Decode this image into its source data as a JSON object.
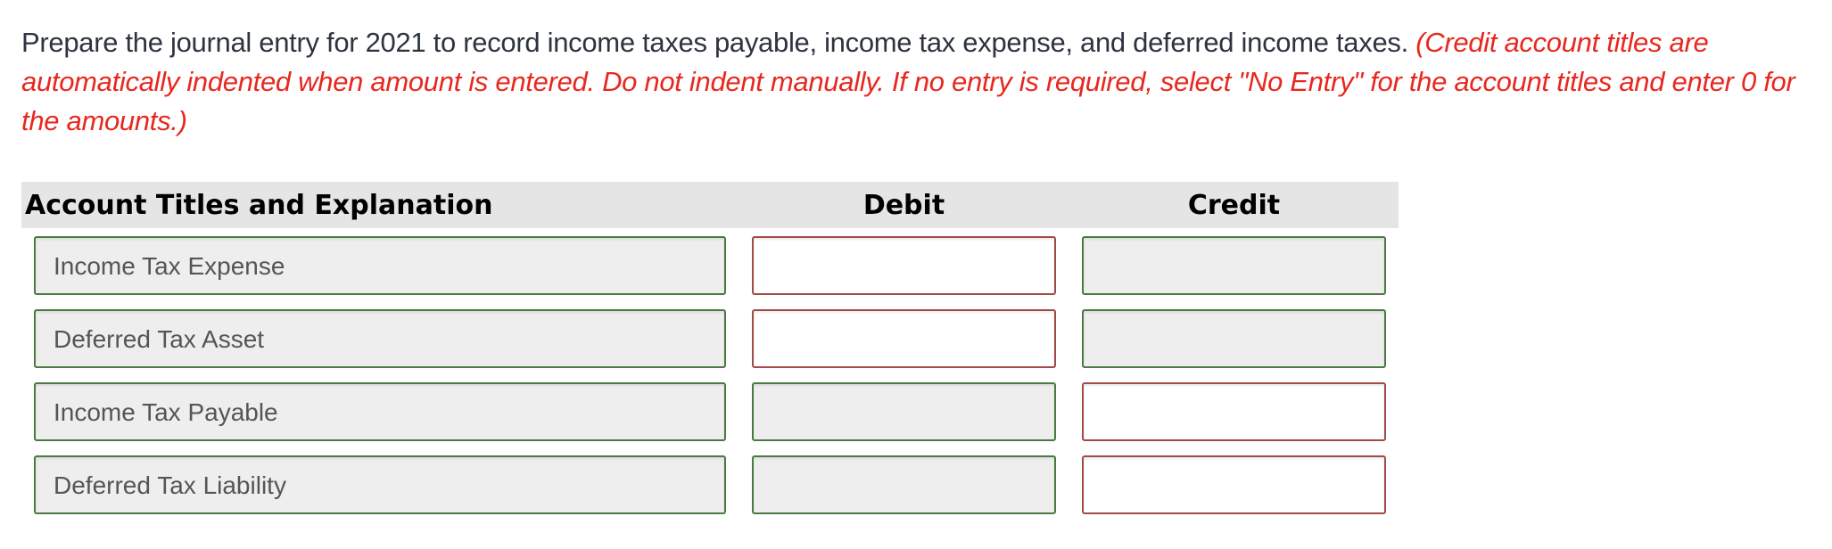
{
  "instructions": {
    "text": "Prepare the journal entry for 2021 to record income taxes payable, income tax expense, and deferred income taxes.",
    "note": "(Credit account titles are automatically indented when amount is entered. Do not indent manually. If no entry is required, select \"No Entry\" for the account titles and enter 0 for the amounts.)"
  },
  "table": {
    "headers": {
      "account": "Account Titles and Explanation",
      "debit": "Debit",
      "credit": "Credit"
    },
    "rows": [
      {
        "account": "Income Tax Expense",
        "debit": "",
        "credit": "",
        "account_status": "correct",
        "debit_status": "incorrect",
        "credit_status": "correct"
      },
      {
        "account": "Deferred Tax Asset",
        "debit": "",
        "credit": "",
        "account_status": "correct",
        "debit_status": "incorrect",
        "credit_status": "correct"
      },
      {
        "account": "Income Tax Payable",
        "debit": "",
        "credit": "",
        "account_status": "correct",
        "debit_status": "correct",
        "credit_status": "incorrect"
      },
      {
        "account": "Deferred Tax Liability",
        "debit": "",
        "credit": "",
        "account_status": "correct",
        "debit_status": "correct",
        "credit_status": "incorrect"
      }
    ]
  },
  "colors": {
    "instruction_text": "#2d3440",
    "note_text": "#e8271f",
    "header_bg": "#e5e5e5",
    "correct_border": "#4a7a41",
    "incorrect_border": "#a34a46",
    "filled_bg": "#eeeeee"
  }
}
